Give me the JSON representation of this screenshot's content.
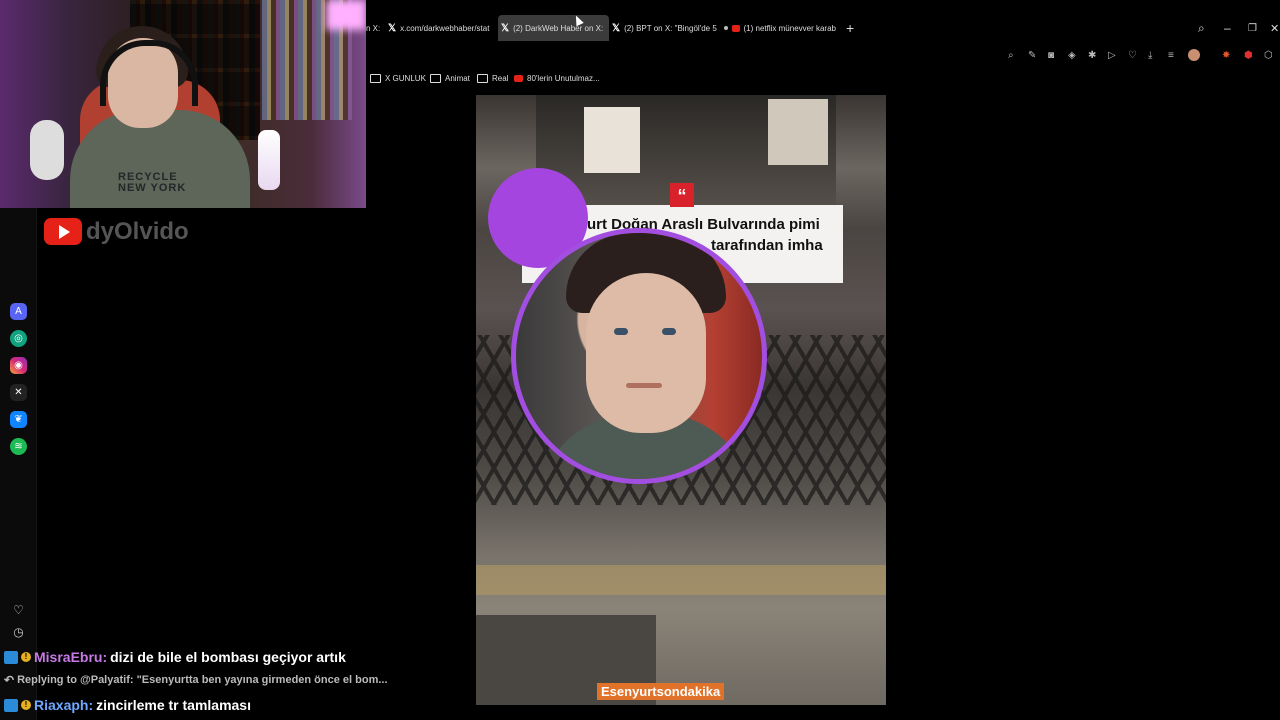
{
  "stream": {
    "channel_name": "dyOlvido",
    "webcam_shirt_text": "RECYCLE\nNEW YORK"
  },
  "browser": {
    "tabs": [
      {
        "label": "n X:",
        "icon": "x-logo-icon",
        "active": false
      },
      {
        "label": "x.com/darkwebhaber/stat",
        "icon": "x-logo-icon",
        "active": false
      },
      {
        "label": "(2) DarkWeb Haber on X:",
        "icon": "x-logo-icon",
        "active": true
      },
      {
        "label": "(2) BPT on X: \"Bingöl'de 5",
        "icon": "x-logo-icon",
        "active": false
      },
      {
        "label": "(1) netflix münevver karab",
        "icon": "youtube-icon",
        "active": false
      }
    ],
    "bookmarks": [
      {
        "label": "X GUNLUK",
        "icon": "folder-icon"
      },
      {
        "label": "Animat",
        "icon": "folder-icon"
      },
      {
        "label": "Real",
        "icon": "folder-icon"
      },
      {
        "label": "80'lerin Unutulmaz...",
        "icon": "youtube-icon"
      }
    ]
  },
  "video": {
    "headline_line1": "urt Doğan Araslı Bulvarında pimi",
    "headline_line2": "tarafından imha",
    "caption": "Esenyurtsondakika"
  },
  "chat": {
    "messages": [
      {
        "user": "MisraEbru:",
        "user_color": "#c77ae6",
        "text": "dizi de bile el bombası geçiyor artık"
      },
      {
        "reply_to": "Replying to @Palyatif: \"Esenyurtta ben yayına girmeden önce el bom..."
      },
      {
        "user": "Riaxaph:",
        "user_color": "#6fa8ff",
        "text": "zincirleme tr tamlaması"
      }
    ]
  },
  "colors": {
    "accent_purple": "#a545e0",
    "youtube_red": "#e62117",
    "quote_red": "#d8212b",
    "caption_orange": "#e0722a"
  }
}
